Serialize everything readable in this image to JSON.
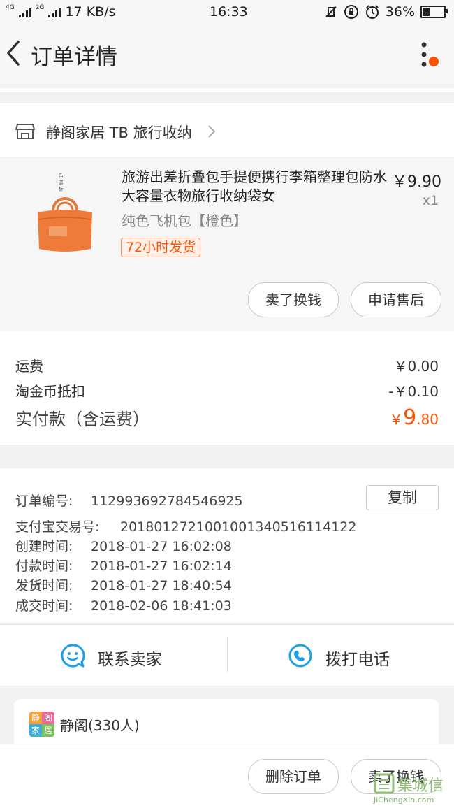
{
  "status_bar": {
    "network_4g": "4G",
    "network_2g": "2G",
    "speed": "17 KB/s",
    "time": "16:33",
    "battery": "36%",
    "battery_level": 0.36
  },
  "nav": {
    "title": "订单详情",
    "back_icon": "chevron-left-icon",
    "more_icon": "more-vertical-icon",
    "notification_color": "#ff5000"
  },
  "shop": {
    "name": "静阁家居 TB 旅行收纳",
    "icon": "store-icon"
  },
  "product": {
    "title": "旅游出差折叠包手提便携行李箱整理包防水大容量衣物旅行收纳袋女",
    "price": "￥9.90",
    "quantity": "x1",
    "spec": "纯色飞机包【橙色】",
    "badge": "72小时发货",
    "image_label": "色 谱 析",
    "actions": [
      "卖了换钱",
      "申请售后"
    ]
  },
  "fees": {
    "shipping_label": "运费",
    "shipping_value": "￥0.00",
    "coin_label": "淘金币抵扣",
    "coin_value": "-￥0.10",
    "total_label": "实付款（含运费）",
    "total_currency": "￥",
    "total_int": "9",
    "total_dec": ".80",
    "accent": "#ff5000"
  },
  "order_info": {
    "order_no_label": "订单编号:",
    "order_no": "112993692784546925",
    "copy_label": "复制",
    "alipay_label": "支付宝交易号:",
    "alipay_no": "2018012721001001340516114122",
    "created_label": "创建时间:",
    "created": "2018-01-27 16:02:08",
    "paid_label": "付款时间:",
    "paid": "2018-01-27 16:02:14",
    "shipped_label": "发货时间:",
    "shipped": "2018-01-27 18:40:54",
    "done_label": "成交时间:",
    "done": "2018-02-06 18:41:03"
  },
  "contact": {
    "seller_label": "联系卖家",
    "seller_icon": "chat-icon",
    "phone_label": "拨打电话",
    "phone_icon": "phone-icon",
    "icon_color": "#1ea0e8"
  },
  "group": {
    "name": "静阁(330人)",
    "avatar_chars": [
      "静",
      "阁",
      "家",
      "居"
    ]
  },
  "bottom": {
    "actions": [
      "删除订单",
      "卖了换钱"
    ]
  },
  "watermark": {
    "cn": "集城信",
    "en": "JiChengXin.com"
  }
}
